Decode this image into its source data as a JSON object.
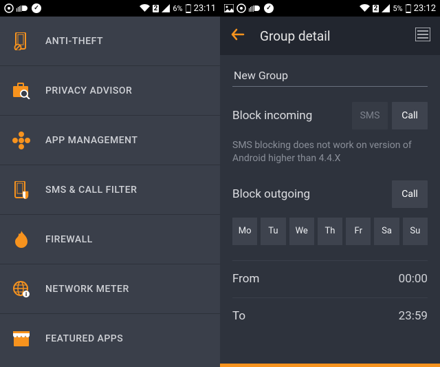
{
  "left": {
    "status": {
      "sim": "2",
      "battery_pct": "6%",
      "time": "23:11"
    },
    "menu": [
      {
        "key": "anti-theft",
        "label": "ANTI-THEFT"
      },
      {
        "key": "privacy-advisor",
        "label": "PRIVACY ADVISOR"
      },
      {
        "key": "app-management",
        "label": "APP MANAGEMENT"
      },
      {
        "key": "sms-call-filter",
        "label": "SMS & CALL FILTER"
      },
      {
        "key": "firewall",
        "label": "FIREWALL"
      },
      {
        "key": "network-meter",
        "label": "NETWORK METER"
      },
      {
        "key": "featured-apps",
        "label": "FEATURED APPS"
      }
    ]
  },
  "right": {
    "status": {
      "sim": "2",
      "battery_pct": "5%",
      "time": "23:12"
    },
    "header": {
      "title": "Group detail"
    },
    "group_name": "New Group",
    "block_incoming": {
      "label": "Block incoming",
      "sms": "SMS",
      "call": "Call"
    },
    "note": "SMS blocking does not work on version of Android higher than 4.4.X",
    "block_outgoing": {
      "label": "Block outgoing",
      "call": "Call"
    },
    "days": [
      "Mo",
      "Tu",
      "We",
      "Th",
      "Fr",
      "Sa",
      "Su"
    ],
    "from": {
      "label": "From",
      "value": "00:00"
    },
    "to": {
      "label": "To",
      "value": "23:59"
    }
  },
  "colors": {
    "accent": "#f7931e",
    "panel_dark": "#2e333d",
    "panel_mid": "#3a3f4a"
  }
}
